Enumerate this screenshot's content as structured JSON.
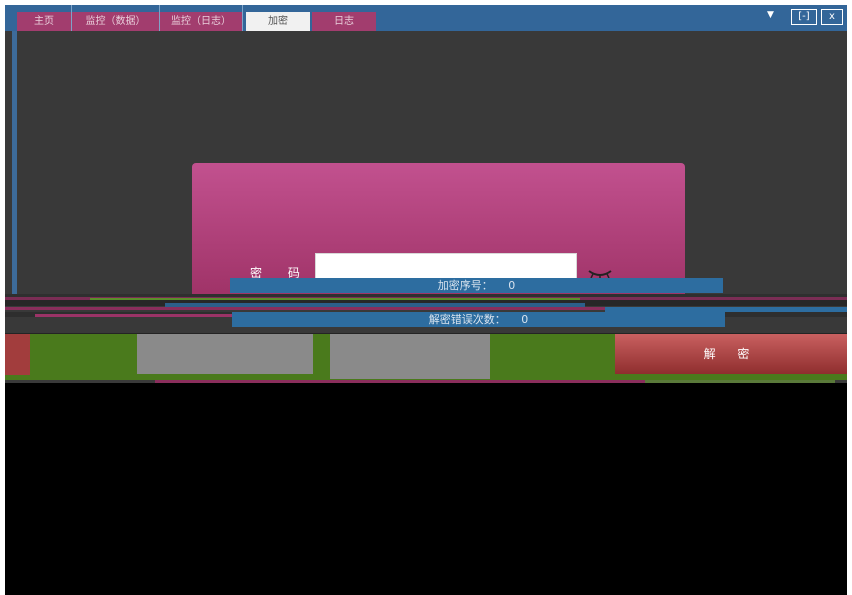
{
  "titlebar": {
    "tabs": [
      {
        "label": "主页"
      },
      {
        "label": "监控（数据）"
      },
      {
        "label": "监控（日志）"
      },
      {
        "label": "加密"
      },
      {
        "label": "日志"
      }
    ],
    "dropdown_glyph": "▼",
    "controls": {
      "restore": "[-]",
      "close": "x"
    }
  },
  "dialog": {
    "password_label": "密 码",
    "password_value": "",
    "eye_icon": "eye-closed-icon"
  },
  "info": {
    "encrypt_index_label": "加密序号：",
    "encrypt_index_value": "0",
    "error_count_label": "解密错误次数：",
    "error_count_value": "0"
  },
  "actions": {
    "decrypt_label": "解 密"
  },
  "colors": {
    "titlebar": "#336699",
    "tab": "#a23d6e",
    "dialog_top": "#c2518f",
    "dialog_bottom": "#9e3266",
    "info_bar": "#2d6da0",
    "button": "#b24848",
    "green": "#4a7a1c",
    "gray": "#8a8a8a"
  }
}
